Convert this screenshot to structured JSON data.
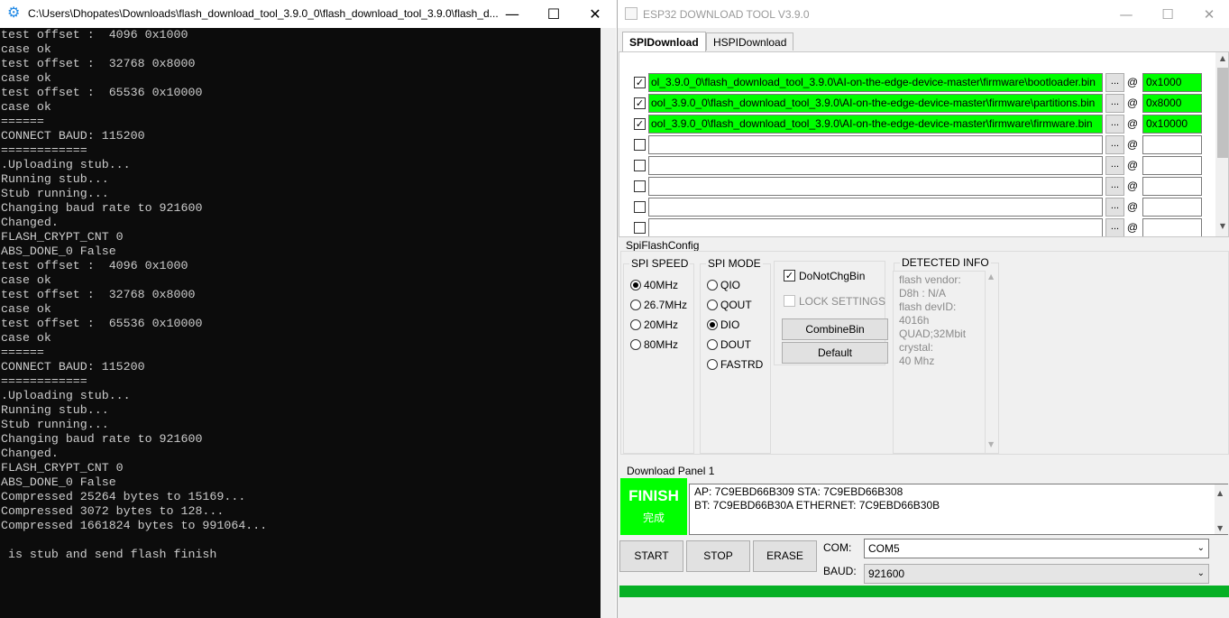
{
  "console": {
    "title": "C:\\Users\\Dhopates\\Downloads\\flash_download_tool_3.9.0_0\\flash_download_tool_3.9.0\\flash_d...",
    "lines": [
      "test offset :  4096 0x1000",
      "case ok",
      "test offset :  32768 0x8000",
      "case ok",
      "test offset :  65536 0x10000",
      "case ok",
      "======",
      "CONNECT BAUD: 115200",
      "============",
      ".Uploading stub...",
      "Running stub...",
      "Stub running...",
      "Changing baud rate to 921600",
      "Changed.",
      "FLASH_CRYPT_CNT 0",
      "ABS_DONE_0 False",
      "test offset :  4096 0x1000",
      "case ok",
      "test offset :  32768 0x8000",
      "case ok",
      "test offset :  65536 0x10000",
      "case ok",
      "======",
      "CONNECT BAUD: 115200",
      "============",
      ".Uploading stub...",
      "Running stub...",
      "Stub running...",
      "Changing baud rate to 921600",
      "Changed.",
      "FLASH_CRYPT_CNT 0",
      "ABS_DONE_0 False",
      "Compressed 25264 bytes to 15169...",
      "Compressed 3072 bytes to 128...",
      "Compressed 1661824 bytes to 991064...",
      "",
      " is stub and send flash finish"
    ]
  },
  "tool": {
    "title": "ESP32 DOWNLOAD TOOL V3.9.0",
    "tabs": [
      "SPIDownload",
      "HSPIDownload"
    ],
    "files": [
      {
        "checked": true,
        "path": "ol_3.9.0_0\\flash_download_tool_3.9.0\\AI-on-the-edge-device-master\\firmware\\bootloader.bin",
        "offset": "0x1000"
      },
      {
        "checked": true,
        "path": "ool_3.9.0_0\\flash_download_tool_3.9.0\\AI-on-the-edge-device-master\\firmware\\partitions.bin",
        "offset": "0x8000"
      },
      {
        "checked": true,
        "path": "ool_3.9.0_0\\flash_download_tool_3.9.0\\AI-on-the-edge-device-master\\firmware\\firmware.bin",
        "offset": "0x10000"
      },
      {
        "checked": false,
        "path": "",
        "offset": ""
      },
      {
        "checked": false,
        "path": "",
        "offset": ""
      },
      {
        "checked": false,
        "path": "",
        "offset": ""
      },
      {
        "checked": false,
        "path": "",
        "offset": ""
      },
      {
        "checked": false,
        "path": "",
        "offset": ""
      }
    ],
    "browse_label": "...",
    "at_label": "@",
    "spiflash_label": "SpiFlashConfig",
    "spi_speed": {
      "title": "SPI SPEED",
      "options": [
        "40MHz",
        "26.7MHz",
        "20MHz",
        "80MHz"
      ],
      "selected": 0
    },
    "spi_mode": {
      "title": "SPI MODE",
      "options": [
        "QIO",
        "QOUT",
        "DIO",
        "DOUT",
        "FASTRD"
      ],
      "selected": 2
    },
    "do_not_chg_bin": "DoNotChgBin",
    "lock_settings": "LOCK SETTINGS",
    "combine_bin": "CombineBin",
    "default": "Default",
    "detected": {
      "title": "DETECTED INFO",
      "lines": [
        "flash vendor:",
        "D8h : N/A",
        "flash devID:",
        "4016h",
        "QUAD;32Mbit",
        "crystal:",
        "40 Mhz"
      ]
    },
    "download_panel_label": "Download Panel 1",
    "finish": {
      "title": "FINISH",
      "sub": "完成"
    },
    "mac_lines": [
      "AP:  7C9EBD66B309  STA:  7C9EBD66B308",
      "BT:  7C9EBD66B30A  ETHERNET:  7C9EBD66B30B"
    ],
    "buttons": {
      "start": "START",
      "stop": "STOP",
      "erase": "ERASE"
    },
    "com_label": "COM:",
    "com_value": "COM5",
    "baud_label": "BAUD:",
    "baud_value": "921600",
    "progress": 1.0
  },
  "colors": {
    "finish_green": "#00ff00",
    "progress_green": "#06b025",
    "console_bg": "#0c0c0c"
  }
}
